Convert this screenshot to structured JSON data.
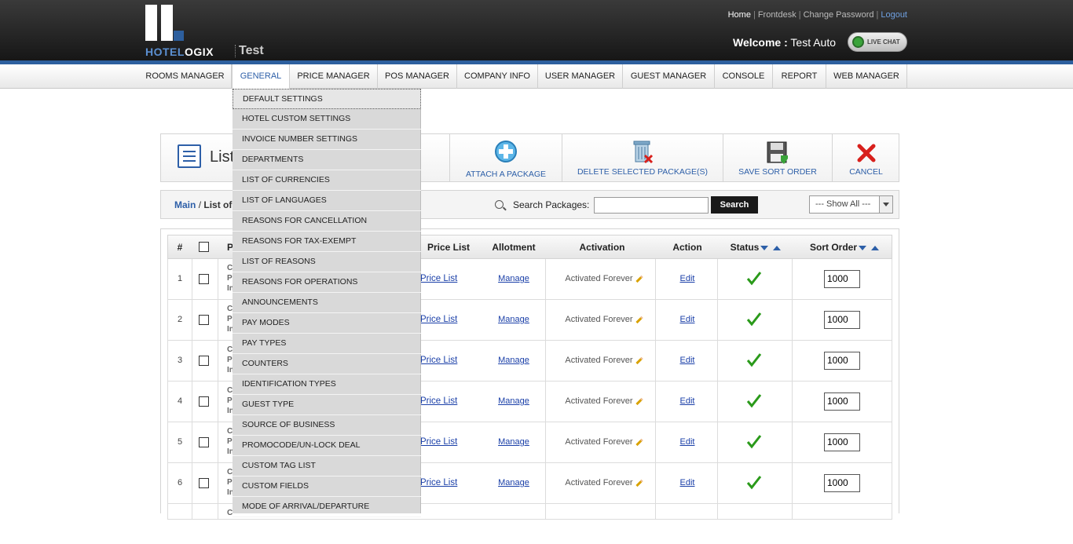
{
  "header": {
    "logo_text_a": "HOTEL",
    "logo_text_b": "OGIX",
    "hotel_name": "Test",
    "links": {
      "home": "Home",
      "frontdesk": "Frontdesk",
      "change_password": "Change Password",
      "logout": "Logout",
      "separator": "|"
    },
    "welcome_label": "Welcome :",
    "welcome_user": "Test Auto",
    "live_chat": "LIVE CHAT"
  },
  "nav": {
    "items": [
      "ROOMS MANAGER",
      "GENERAL",
      "PRICE MANAGER",
      "POS MANAGER",
      "COMPANY INFO",
      "USER MANAGER",
      "GUEST MANAGER",
      "CONSOLE",
      "REPORT",
      "WEB MANAGER"
    ],
    "active": "GENERAL"
  },
  "general_menu": [
    "DEFAULT SETTINGS",
    "HOTEL CUSTOM SETTINGS",
    "INVOICE NUMBER SETTINGS",
    "DEPARTMENTS",
    "LIST OF CURRENCIES",
    "LIST OF LANGUAGES",
    "REASONS FOR CANCELLATION",
    "REASONS FOR TAX-EXEMPT",
    "LIST OF REASONS",
    "REASONS FOR OPERATIONS",
    "ANNOUNCEMENTS",
    "PAY MODES",
    "PAY TYPES",
    "COUNTERS",
    "IDENTIFICATION TYPES",
    "GUEST TYPE",
    "SOURCE OF BUSINESS",
    "PROMOCODE/UN-LOCK DEAL",
    "CUSTOM TAG LIST",
    "CUSTOM FIELDS",
    "MODE OF ARRIVAL/DEPARTURE"
  ],
  "page": {
    "title_fragment": "List",
    "actions": {
      "attach": "ATTACH A PACKAGE",
      "delete": "DELETE SELECTED PACKAGE(S)",
      "save_sort": "SAVE SORT ORDER",
      "cancel": "CANCEL"
    },
    "breadcrumb": {
      "main": "Main",
      "separator": "/",
      "current_fragment": "List of"
    },
    "search": {
      "label": "Search Packages:",
      "value": "",
      "button": "Search"
    },
    "filter": {
      "selected": "--- Show All ---"
    }
  },
  "table": {
    "headers": {
      "num": "#",
      "package_fragment": "P",
      "price_list": "Price List",
      "allotment": "Allotment",
      "activation": "Activation",
      "action": "Action",
      "status": "Status",
      "sort_order": "Sort Order"
    },
    "rows": [
      {
        "num": "1",
        "pkg": [
          "C",
          "P",
          "In"
        ],
        "price_list": "Price List",
        "allotment": "Manage",
        "activation": "Activated Forever",
        "action": "Edit",
        "sort_order": "1000"
      },
      {
        "num": "2",
        "pkg": [
          "C",
          "P",
          "In"
        ],
        "price_list": "Price List",
        "allotment": "Manage",
        "activation": "Activated Forever",
        "action": "Edit",
        "sort_order": "1000"
      },
      {
        "num": "3",
        "pkg": [
          "C",
          "P",
          "In"
        ],
        "price_list": "Price List",
        "allotment": "Manage",
        "activation": "Activated Forever",
        "action": "Edit",
        "sort_order": "1000"
      },
      {
        "num": "4",
        "pkg": [
          "C",
          "P",
          "In"
        ],
        "price_list": "Price List",
        "allotment": "Manage",
        "activation": "Activated Forever",
        "action": "Edit",
        "sort_order": "1000"
      },
      {
        "num": "5",
        "pkg": [
          "C",
          "P",
          "In"
        ],
        "price_list": "Price List",
        "allotment": "Manage",
        "activation": "Activated Forever",
        "action": "Edit",
        "sort_order": "1000"
      },
      {
        "num": "6",
        "pkg": [
          "C",
          "P",
          "In"
        ],
        "price_list": "Price List",
        "allotment": "Manage",
        "activation": "Activated Forever",
        "action": "Edit",
        "sort_order": "1000"
      },
      {
        "num": "",
        "pkg": [
          "C",
          "",
          ""
        ],
        "price_list": "",
        "allotment": "",
        "activation": "",
        "action": "",
        "sort_order": ""
      }
    ]
  },
  "colors": {
    "brand_blue": "#2d5fa8",
    "header_dark": "#1e1e1e",
    "status_green": "#2a9a1a",
    "cancel_red": "#d8201c"
  }
}
